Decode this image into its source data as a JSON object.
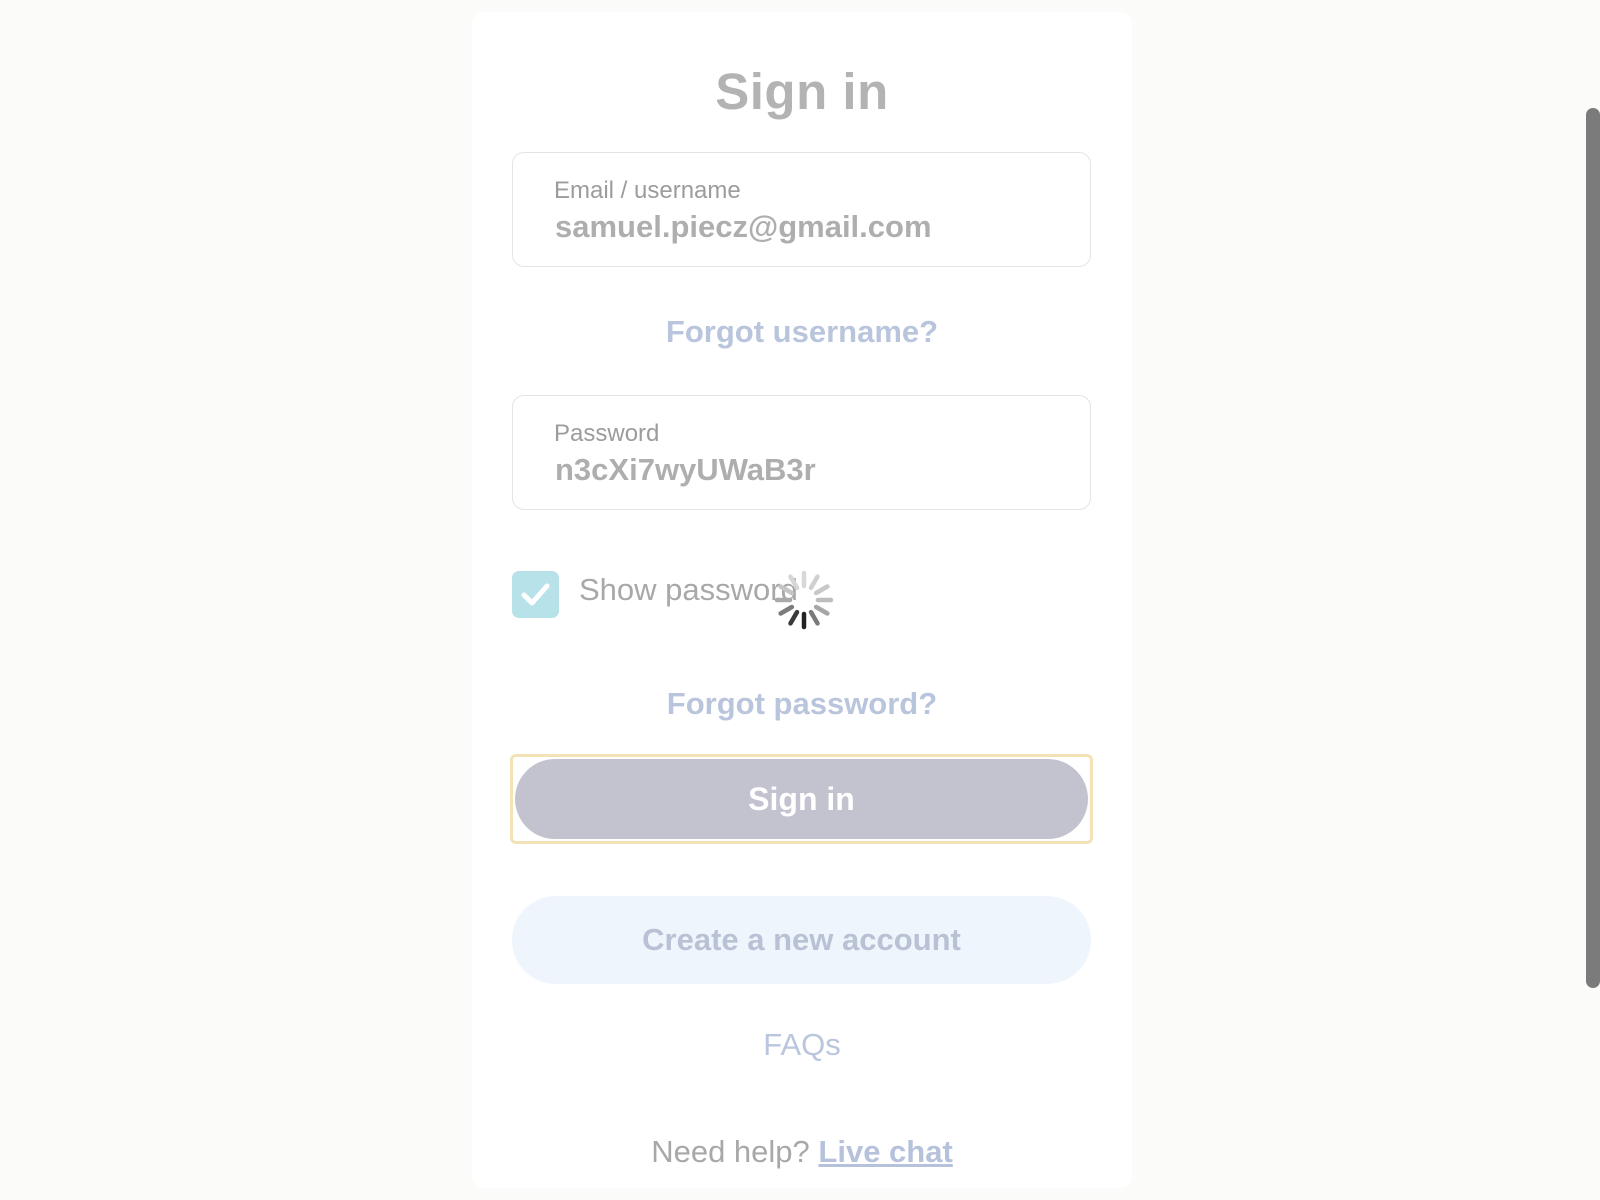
{
  "title": "Sign in",
  "email": {
    "label": "Email / username",
    "value": "samuel.piecz@gmail.com"
  },
  "forgot_username": "Forgot username?",
  "password": {
    "label": "Password",
    "value": "n3cXi7wyUWaB3r"
  },
  "show_password": {
    "label": "Show password",
    "checked": true
  },
  "forgot_password": "Forgot password?",
  "sign_in_button": "Sign in",
  "create_account_button": "Create a new account",
  "faqs": "FAQs",
  "help": {
    "prefix": "Need help?",
    "link": "Live chat"
  },
  "icons": {
    "checkbox": "checkmark-icon",
    "loading": "loading-spinner-icon"
  },
  "colors": {
    "link": "#b9c5dc",
    "signin_bg": "#c3c2cf",
    "create_bg": "#eef5fc",
    "checkbox_bg": "#b7e2e9",
    "focus_ring": "#f2e2b6"
  }
}
